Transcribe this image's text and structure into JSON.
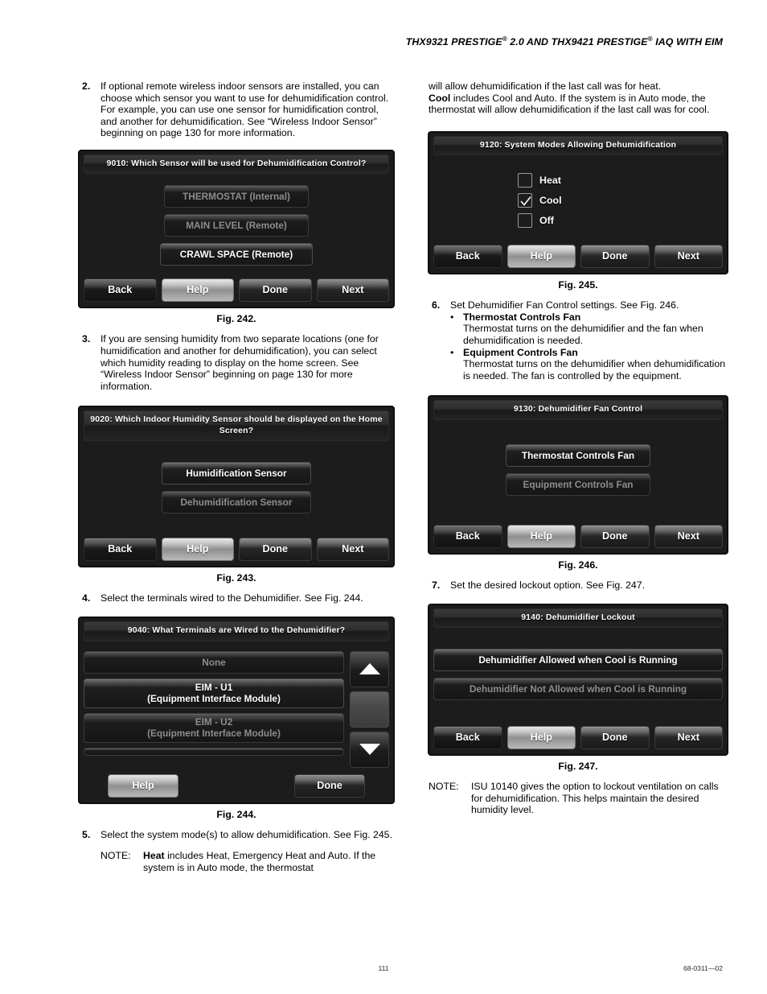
{
  "header": {
    "title_part1": "THX9321 PRESTIGE",
    "sup1": "®",
    "title_part2": " 2.0 AND THX9421 PRESTIGE",
    "sup2": "®",
    "title_part3": " IAQ WITH EIM"
  },
  "footer": {
    "page_number": "111",
    "document_code": "68-0311—02"
  },
  "left_column": {
    "step2": {
      "number": "2.",
      "text": "If optional remote wireless indoor sensors are installed, you can choose which sensor you want to use for dehumidification control. For example, you can use one sensor for humidification control, and another for dehumidification. See “Wireless Indoor Sensor” beginning on page 130 for more information."
    },
    "fig242": {
      "caption": "Fig. 242.",
      "screen": {
        "title": "9010: Which Sensor will be used for Dehumidification Control?",
        "options": [
          {
            "label": "THERMOSTAT (Internal)",
            "selected": false
          },
          {
            "label": "MAIN LEVEL (Remote)",
            "selected": false
          },
          {
            "label": "CRAWL SPACE (Remote)",
            "selected": true
          }
        ],
        "nav": [
          "Back",
          "Help",
          "Done",
          "Next"
        ]
      }
    },
    "step3": {
      "number": "3.",
      "text": "If you are sensing humidity from two separate locations (one for humidification and another for dehumidification), you can select which humidity reading to display on the home screen. See “Wireless Indoor Sensor” beginning on page 130 for more information."
    },
    "fig243": {
      "caption": "Fig. 243.",
      "screen": {
        "title": "9020: Which Indoor Humidity Sensor should be displayed on the Home Screen?",
        "options": [
          {
            "label": "Humidification Sensor",
            "selected": true
          },
          {
            "label": "Dehumidification Sensor",
            "selected": false
          }
        ],
        "nav": [
          "Back",
          "Help",
          "Done",
          "Next"
        ]
      }
    },
    "step4": {
      "number": "4.",
      "text": "Select the terminals wired to the Dehumidifier. See Fig. 244."
    },
    "fig244": {
      "caption": "Fig. 244.",
      "screen": {
        "title": "9040: What Terminals are Wired to the Dehumidifier?",
        "options": [
          {
            "label": "None",
            "line2": "",
            "selected": false
          },
          {
            "label": "EIM - U1",
            "line2": "(Equipment Interface Module)",
            "selected": true
          },
          {
            "label": "EIM - U2",
            "line2": "(Equipment Interface Module)",
            "selected": false
          }
        ],
        "scroll_up_icon": "triangle-up-icon",
        "scroll_down_icon": "triangle-down-icon",
        "nav": [
          "Help",
          "Done"
        ]
      }
    },
    "step5": {
      "number": "5.",
      "text": "Select the system mode(s) to allow dehumidification. See Fig. 245.",
      "note_label": "NOTE:",
      "note_lead": "Heat",
      "note_text": " includes Heat, Emergency Heat and Auto. If the system is in Auto mode, the thermostat"
    }
  },
  "right_column": {
    "continued": {
      "line1": "will allow dehumidification if the last call was for heat.",
      "lead2": "Cool",
      "line2": " includes Cool and Auto. If the system is in Auto mode, the thermostat will allow dehumidification if the last call was for cool."
    },
    "fig245": {
      "caption": "Fig. 245.",
      "screen": {
        "title": "9120: System Modes Allowing Dehumidification",
        "checkboxes": [
          {
            "label": "Heat",
            "checked": false
          },
          {
            "label": "Cool",
            "checked": true
          },
          {
            "label": "Off",
            "checked": false
          }
        ],
        "nav": [
          "Back",
          "Help",
          "Done",
          "Next"
        ]
      }
    },
    "step6": {
      "number": "6.",
      "text": "Set Dehumidifier Fan Control settings. See Fig. 246.",
      "bullets": [
        {
          "lead": "Thermostat Controls Fan",
          "text": "Thermostat turns on the dehumidifier and the fan when dehumidification is needed."
        },
        {
          "lead": "Equipment Controls Fan",
          "text": "Thermostat turns on the dehumidifier when dehumidification is needed. The fan is controlled by the equipment."
        }
      ]
    },
    "fig246": {
      "caption": "Fig. 246.",
      "screen": {
        "title": "9130: Dehumidifier Fan Control",
        "options": [
          {
            "label": "Thermostat Controls Fan",
            "selected": true
          },
          {
            "label": "Equipment Controls Fan",
            "selected": false
          }
        ],
        "nav": [
          "Back",
          "Help",
          "Done",
          "Next"
        ]
      }
    },
    "step7": {
      "number": "7.",
      "text": "Set the desired lockout option. See Fig. 247."
    },
    "fig247": {
      "caption": "Fig. 247.",
      "screen": {
        "title": "9140: Dehumidifier Lockout",
        "options": [
          {
            "label": "Dehumidifier Allowed when Cool is Running",
            "selected": true
          },
          {
            "label": "Dehumidifier Not Allowed when Cool is Running",
            "selected": false
          }
        ],
        "nav": [
          "Back",
          "Help",
          "Done",
          "Next"
        ]
      }
    },
    "final_note": {
      "label": "NOTE:",
      "text": "ISU 10140 gives the option to lockout ventilation on calls for dehumidification. This helps maintain the desired humidity level."
    }
  },
  "colors": {
    "screen_bg": "#1c1c1c",
    "text_on_screen": "#ffffff",
    "dim_text": "#8d8d8d",
    "page_bg": "#ffffff"
  }
}
